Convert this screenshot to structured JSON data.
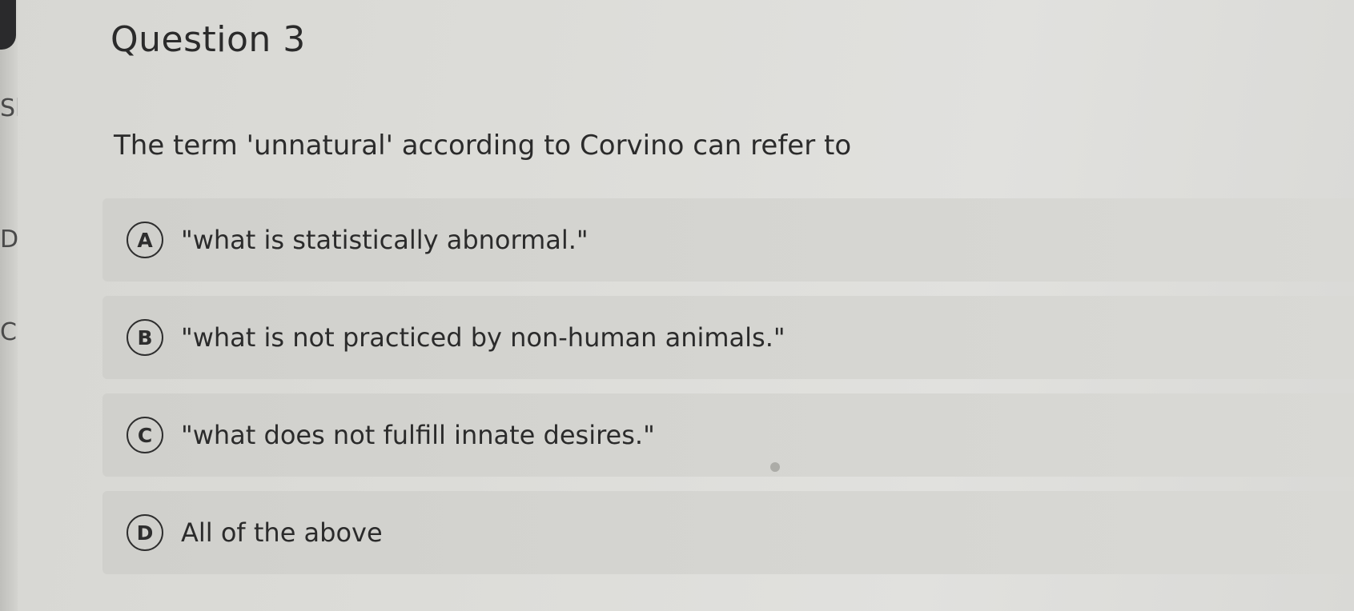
{
  "question": {
    "title": "Question 3",
    "prompt": "The term 'unnatural' according to Corvino can refer to"
  },
  "options": [
    {
      "letter": "A",
      "text": "\"what is statistically abnormal.\""
    },
    {
      "letter": "B",
      "text": "\"what is not practiced by non-human animals.\""
    },
    {
      "letter": "C",
      "text": "\"what does not fulfill innate desires.\""
    },
    {
      "letter": "D",
      "text": "All of the above"
    }
  ],
  "edge": {
    "glyph_1": "Sl",
    "glyph_2": "D",
    "glyph_3": "C"
  }
}
